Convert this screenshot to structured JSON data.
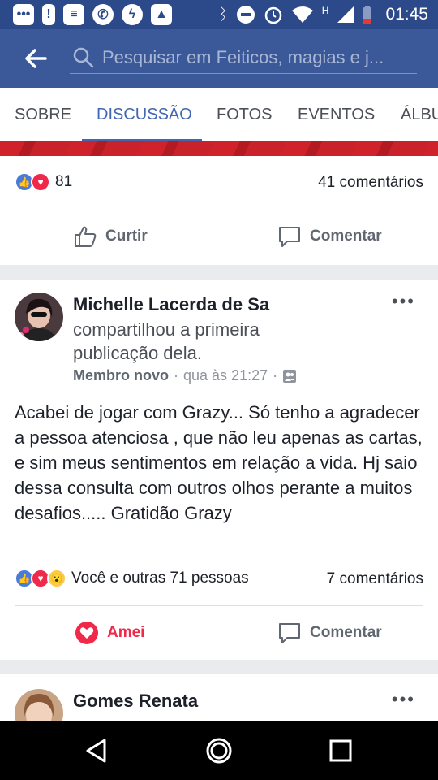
{
  "status_bar": {
    "time": "01:45",
    "network": "H"
  },
  "search": {
    "placeholder": "Pesquisar em Feiticos, magias e j..."
  },
  "tabs": [
    {
      "label": "SOBRE"
    },
    {
      "label": "DISCUSSÃO"
    },
    {
      "label": "FOTOS"
    },
    {
      "label": "EVENTOS"
    },
    {
      "label": "ÁLBU"
    }
  ],
  "post1": {
    "reaction_count": "81",
    "comments": "41 comentários",
    "like_label": "Curtir",
    "comment_label": "Comentar"
  },
  "post2": {
    "author": "Michelle Lacerda de Sa",
    "shared_text": "compartilhou a primeira publicação dela.",
    "badge": "Membro novo",
    "separator": "·",
    "time": "qua às 21:27",
    "text": "Acabei de jogar com Grazy... Só tenho a agradecer a pessoa atenciosa , que não leu apenas as cartas, e sim meus sentimentos em relação a vida. Hj saio dessa consulta com outros olhos perante a muitos desafios..... Gratidão Grazy",
    "reactions_text": "Você e outras 71 pessoas",
    "comments": "7 comentários",
    "love_label": "Amei",
    "comment_label": "Comentar"
  },
  "post3": {
    "author": "Gomes Renata"
  },
  "colors": {
    "brand": "#3b5998",
    "active_tab": "#4267b2",
    "love": "#f0284a"
  }
}
